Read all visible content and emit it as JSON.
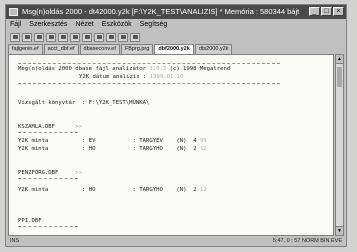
{
  "window": {
    "title": "Msg(n)oldás 2000 - dt42000.y2k   [F:\\Y2K_TEST\\ANALIZIS] * Memória : 580344 bájt",
    "controls": [
      "_",
      "□",
      "×"
    ]
  },
  "menu": [
    "Fájl",
    "Szerkesztés",
    "Nézet",
    "Eszközök",
    "Segítség"
  ],
  "tabs": [
    {
      "label": "fajlgenin.ef"
    },
    {
      "label": "acct_dbf.ef"
    },
    {
      "label": "dbaseconv.ef"
    },
    {
      "label": "FBprg.prg"
    },
    {
      "label": "dbf2000.y2k"
    },
    {
      "label": "dts2000.y2k"
    }
  ],
  "document": {
    "header_line1": "Meg(n)oldás 2000 dbase fájl analizátor",
    "header_version": "1.0.3",
    "header_copyright": "(c) 1998 Megatrend",
    "header_line2": "Y2K dátum analízis :",
    "header_date": "1999.01.10",
    "dir_label": "Vizsgált könyvtár  : F:\\Y2K_TEST\\MUNKA\\",
    "sections": [
      {
        "file": "KSZAMLA.DBF",
        "marker": ">>",
        "rows": [
          {
            "label": "Y2K minta",
            "sep": ": EV",
            "field": ": TARGYEV",
            "type": "(N)",
            "size": "4",
            "extra": "99"
          },
          {
            "label": "Y2K minta",
            "sep": ": HO",
            "field": ": TARGYHO",
            "type": "(N)",
            "size": "2",
            "extra": "12"
          }
        ]
      },
      {
        "file": "PENZFORG.DBF",
        "marker": ">>",
        "rows": [
          {
            "label": "Y2K minta",
            "sep": ": HO",
            "field": ": TARGYHO",
            "type": "(N)",
            "size": "2",
            "extra": "12"
          }
        ]
      },
      {
        "file": "PPI.DBF",
        "marker": "",
        "rows": []
      }
    ]
  },
  "status": {
    "left": "INS",
    "right": "5:47, 0 : 57  NORM  BIN  EVE"
  }
}
